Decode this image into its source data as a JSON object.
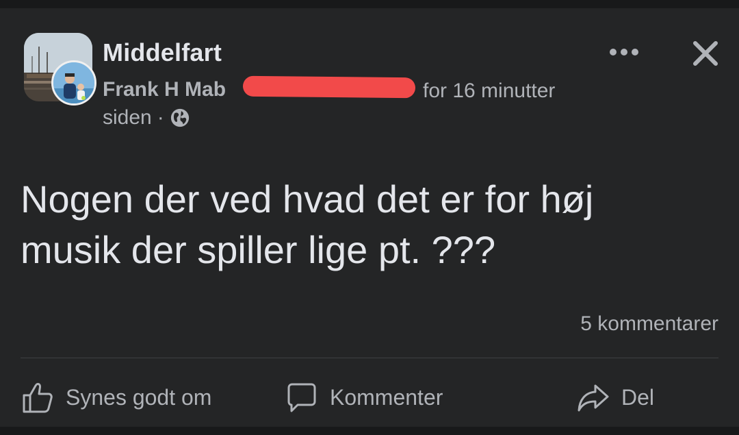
{
  "post": {
    "group_name": "Middelfart",
    "author_name": "Frank H Mab",
    "time_line1": "for 16 minutter",
    "time_line2": "siden",
    "separator": "·",
    "privacy_icon": "globe-icon",
    "body_line1": "Nogen der ved hvad det er for høj",
    "body_line2": "musik der spiller lige pt. ???",
    "comments_count": "5 kommentarer"
  },
  "header_actions": {
    "more_icon": "more-dots-icon",
    "close_icon": "close-icon"
  },
  "actions": {
    "like_label": "Synes godt om",
    "comment_label": "Kommenter",
    "share_label": "Del"
  },
  "colors": {
    "background": "#18191a",
    "card": "#242526",
    "primary_text": "#e4e6eb",
    "secondary_text": "#b0b3b8",
    "redaction": "#f24a4a"
  }
}
